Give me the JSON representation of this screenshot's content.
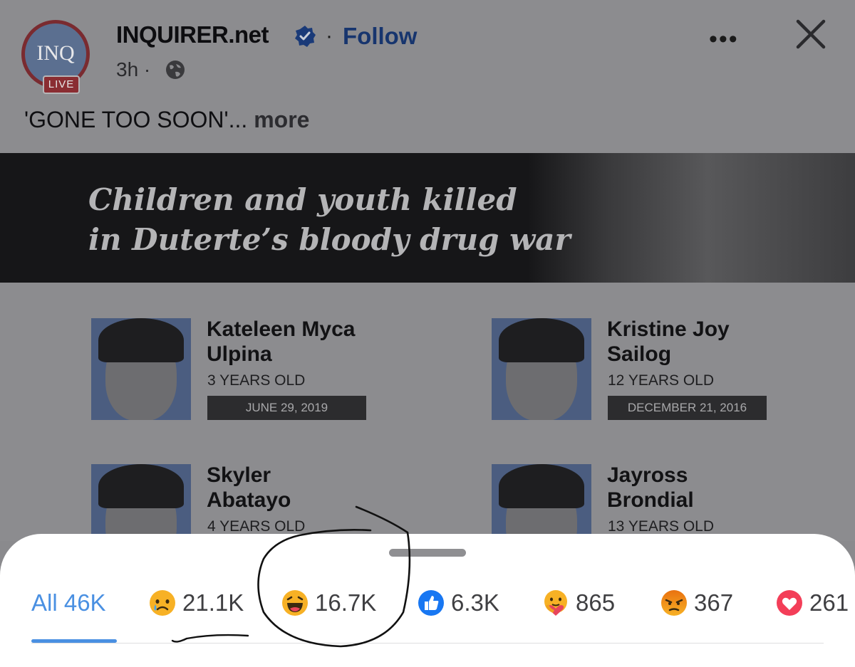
{
  "post": {
    "page_name": "INQUIRER.net",
    "avatar_text": "INQ",
    "avatar_badge": "LIVE",
    "separator": "·",
    "follow_label": "Follow",
    "time": "3h ·",
    "caption_text": "'GONE TOO SOON'...",
    "caption_more": "more"
  },
  "image": {
    "title_line1": "Children and youth killed",
    "title_line2": "in Duterte’s bloody drug war",
    "people": [
      {
        "name1": "Kateleen Myca",
        "name2": "Ulpina",
        "age": "3 YEARS OLD",
        "date": "JUNE 29, 2019"
      },
      {
        "name1": "Kristine Joy",
        "name2": "Sailog",
        "age": "12 YEARS OLD",
        "date": "DECEMBER 21, 2016"
      },
      {
        "name1": "Skyler",
        "name2": "Abatayo",
        "age": "4 YEARS OLD"
      },
      {
        "name1": "Jayross",
        "name2": "Brondial",
        "age": "13 YEARS OLD"
      }
    ]
  },
  "reactions": {
    "all": "All 46K",
    "sad": "21.1K",
    "haha": "16.7K",
    "like": "6.3K",
    "care": "865",
    "angry": "367",
    "love": "261"
  },
  "colors": {
    "accent": "#4a90e2",
    "like": "#1877f2",
    "love": "#f33e58",
    "emoji": "#f7b125",
    "angry": "#e9710f"
  },
  "icons": [
    "verified-badge-icon",
    "globe-icon",
    "more-options-icon",
    "close-icon",
    "sad-emoji-icon",
    "haha-emoji-icon",
    "like-icon",
    "care-emoji-icon",
    "angry-emoji-icon",
    "love-icon"
  ]
}
